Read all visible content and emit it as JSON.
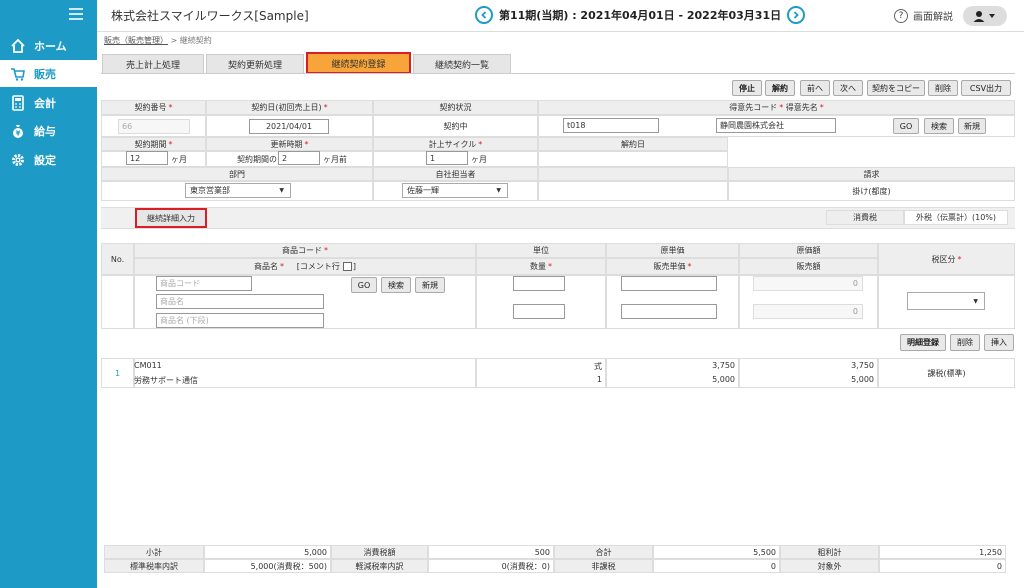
{
  "company": "株式会社スマイルワークス[Sample]",
  "period": "第11期(当期) : 2021年04月01日 - 2022年03月31日",
  "help": "画面解説",
  "colors": {
    "primary": "#1d9bc6",
    "active_tab": "#f7a53a",
    "highlight": "#d81f26"
  },
  "nav": [
    {
      "label": "ホーム",
      "icon": "home-icon"
    },
    {
      "label": "販売",
      "icon": "cart-icon"
    },
    {
      "label": "会計",
      "icon": "calculator-icon"
    },
    {
      "label": "給与",
      "icon": "money-bag-icon"
    },
    {
      "label": "設定",
      "icon": "gear-icon"
    }
  ],
  "breadcrumb": {
    "link": "販売（販売管理）",
    "sep": ">",
    "current": "継続契約"
  },
  "tabs": [
    "売上計上処理",
    "契約更新処理",
    "継続契約登録",
    "継続契約一覧"
  ],
  "actions": [
    "停止",
    "解約",
    "前へ",
    "次へ",
    "契約をコピー",
    "削除",
    "CSV出力"
  ],
  "form": {
    "contract_no_label": "契約番号",
    "contract_no": "66",
    "contract_date_label": "契約日(初回売上日)",
    "contract_date": "2021/04/01",
    "status_label": "契約状況",
    "status": "契約中",
    "customer_label": "得意先コード",
    "customer_name_label": "得意先名",
    "customer_code": "t018",
    "customer_name": "静岡農園株式会社",
    "go": "GO",
    "search": "検索",
    "new": "新規",
    "period_label": "契約期間",
    "period_value": "12",
    "month_unit": "ヶ月",
    "renew_label": "更新時期",
    "renew_prefix": "契約期間の",
    "renew_value": "2",
    "renew_suffix": "ヶ月前",
    "cycle_label": "計上サイクル",
    "cycle_value": "1",
    "cancel_date_label": "解約日",
    "dept_label": "部門",
    "dept_value": "東京営業部",
    "staff_label": "自社担当者",
    "staff_value": "佐藤一輝",
    "billing_label": "請求",
    "billing_value": "掛け(都度)",
    "detail_button": "継続詳細入力",
    "tax_label": "消費税",
    "tax_value": "外税（伝票計）(10%)"
  },
  "lines_header": {
    "no": "No.",
    "product_code": "商品コード",
    "product_name": "商品名",
    "comment_row": "[コメント行",
    "unit": "単位",
    "qty": "数量",
    "cost_price": "原単価",
    "sale_price": "販売単価",
    "cost_amount": "原価額",
    "sale_amount": "販売額",
    "tax_type": "税区分"
  },
  "entry": {
    "code_ph": "商品コード",
    "name_ph": "商品名",
    "name2_ph": "商品名 (下段)",
    "cost_zero": "0",
    "sale_zero": "0",
    "register": "明細登録",
    "delete": "削除",
    "insert": "挿入"
  },
  "lines": [
    {
      "no": "1",
      "code": "CM011",
      "name": "労務サポート通信",
      "unit": "式",
      "qty": "1",
      "cost_price": "3,750",
      "sale_price": "5,000",
      "cost_amount": "3,750",
      "sale_amount": "5,000",
      "tax": "課税(標準)"
    }
  ],
  "totals": {
    "subtotal_label": "小計",
    "subtotal": "5,000",
    "tax_label": "消費税額",
    "tax": "500",
    "total_label": "合計",
    "total": "5,500",
    "gross_label": "粗利計",
    "gross": "1,250",
    "std_label": "標準税率内訳",
    "std": "5,000(消費税：500)",
    "reduced_label": "軽減税率内訳",
    "reduced": "0(消費税：0)",
    "nontax_label": "非課税",
    "nontax": "0",
    "exempt_label": "対象外",
    "exempt": "0"
  }
}
